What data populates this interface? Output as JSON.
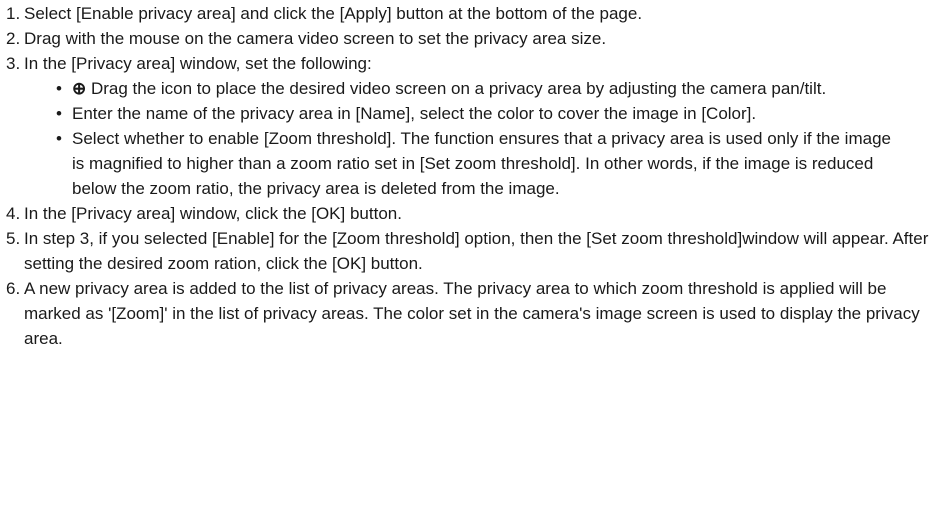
{
  "steps": [
    {
      "num": "1.",
      "text": "Select [Enable privacy area] and click the [Apply] button at the bottom of the page."
    },
    {
      "num": "2.",
      "text": "Drag with the mouse on the camera video screen to set the privacy area size."
    },
    {
      "num": "3.",
      "text": "In the [Privacy area] window, set the following:"
    },
    {
      "num": "4.",
      "text": "In the [Privacy area] window, click the [OK] button."
    },
    {
      "num": "5.",
      "text": "In step 3, if you selected [Enable] for the [Zoom threshold] option, then the [Set zoom threshold]window will appear. After setting the desired zoom ration, click the [OK] button."
    },
    {
      "num": "6.",
      "text": "A new privacy area is added to the list of privacy areas. The privacy area to which zoom threshold is applied will be marked as '[Zoom]' in the list of privacy areas. The color set in the camera's image screen is used to display the privacy area."
    }
  ],
  "step3_bullets": [
    {
      "icon": "⊕",
      "text": " Drag the icon to place the desired video screen on a privacy area by adjusting the camera pan/tilt."
    },
    {
      "text": "Enter the name of the privacy area in [Name], select the color to cover the image in [Color]."
    },
    {
      "text": "Select whether to enable [Zoom threshold]. The function ensures that a privacy area is used only if the image is magnified to higher than a zoom ratio set in [Set zoom threshold]. In other words, if the image is reduced below the zoom ratio, the privacy area is deleted from the image."
    }
  ],
  "bullet_char": "•"
}
